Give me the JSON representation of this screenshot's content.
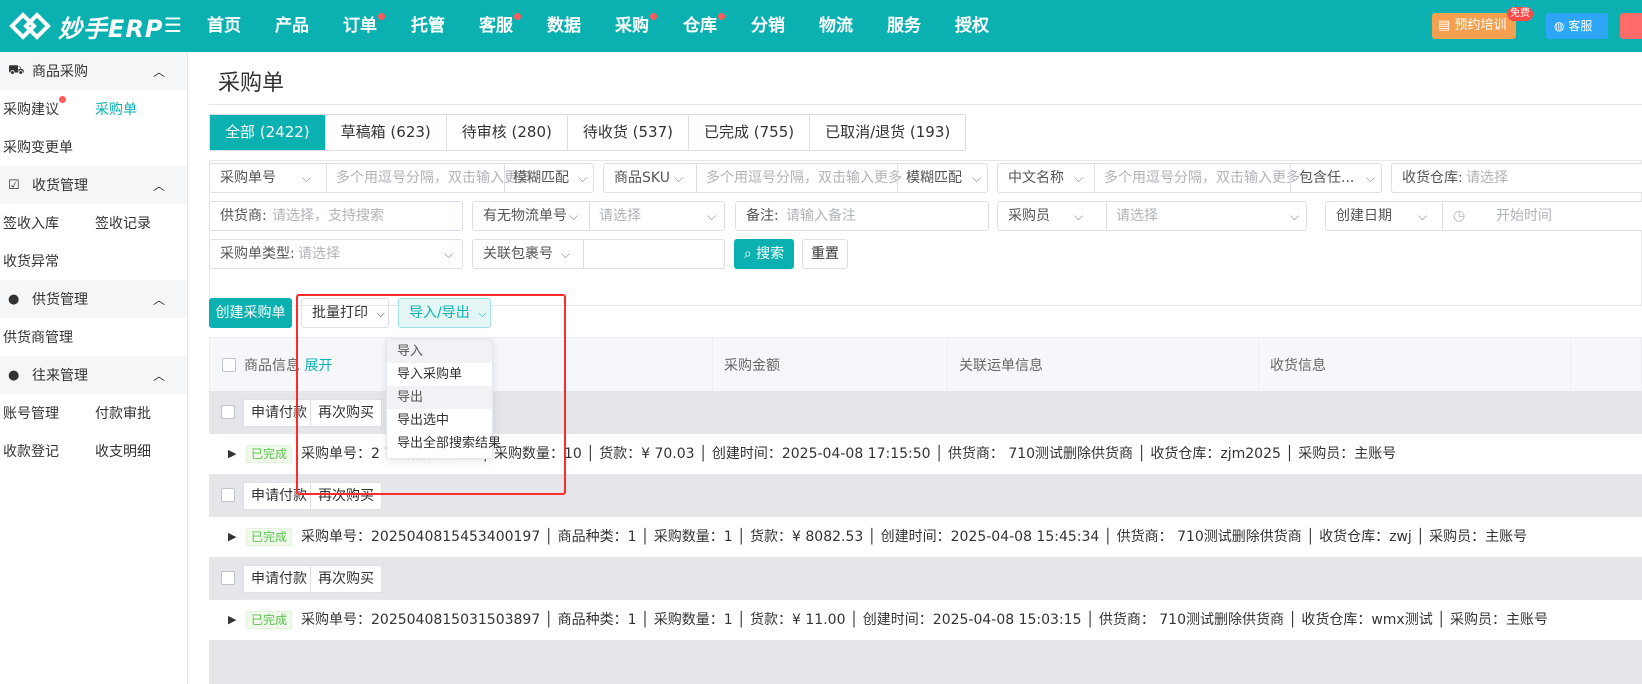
{
  "app": {
    "logo_text": "妙手ERP",
    "nav": [
      {
        "label": "首页",
        "dot": false
      },
      {
        "label": "产品",
        "dot": false
      },
      {
        "label": "订单",
        "dot": true
      },
      {
        "label": "托管",
        "dot": false
      },
      {
        "label": "客服",
        "dot": true
      },
      {
        "label": "数据",
        "dot": false
      },
      {
        "label": "采购",
        "dot": true
      },
      {
        "label": "仓库",
        "dot": true
      },
      {
        "label": "分销",
        "dot": false
      },
      {
        "label": "物流",
        "dot": false
      },
      {
        "label": "服务",
        "dot": false
      },
      {
        "label": "授权",
        "dot": false
      }
    ],
    "training_label": "预约培训",
    "free_badge": "免费",
    "service_label": "客服"
  },
  "sidebar": {
    "groups": [
      {
        "title": "商品采购",
        "icon": "cart-icon",
        "rows": [
          [
            "采购建议",
            "采购单"
          ],
          [
            "采购变更单"
          ]
        ]
      },
      {
        "title": "收货管理",
        "icon": "clipboard-check-icon",
        "rows": [
          [
            "签收入库",
            "签收记录"
          ],
          [
            "收货异常"
          ]
        ]
      },
      {
        "title": "供货管理",
        "icon": "user-gear-icon",
        "rows": [
          [
            "供货商管理"
          ]
        ]
      },
      {
        "title": "往来管理",
        "icon": "user-icon",
        "rows": [
          [
            "账号管理",
            "付款审批"
          ],
          [
            "收款登记",
            "收支明细"
          ]
        ]
      }
    ]
  },
  "page": {
    "title": "采购单"
  },
  "tabs": [
    "全部 (2422)",
    "草稿箱 (623)",
    "待审核 (280)",
    "待收货 (537)",
    "已完成 (755)",
    "已取消/退货 (193)"
  ],
  "filters": {
    "order_no_label": "采购单号",
    "order_no_ph": "多个用逗号分隔，双击输入更多",
    "fuzzy1": "模糊匹配",
    "sku_label": "商品SKU",
    "sku_ph": "多个用逗号分隔，双击输入更多",
    "fuzzy2": "模糊匹配",
    "cn_name_label": "中文名称",
    "cn_name_ph": "多个用逗号分隔，双击输入更多",
    "contains": "包含任...",
    "warehouse_label": "收货仓库:",
    "warehouse_ph": "请选择",
    "supplier_label": "供货商:",
    "supplier_ph": "请选择，支持搜索",
    "logistics_label": "有无物流单号",
    "logistics_ph": "请选择",
    "remark_label": "备注:",
    "remark_ph": "请输入备注",
    "buyer_label": "采购员",
    "buyer_ph": "请选择",
    "date_label": "创建日期",
    "date_ph": "开始时间",
    "type_label": "采购单类型:",
    "type_ph": "请选择",
    "package_label": "关联包裹号",
    "search_btn": "搜索",
    "reset_btn": "重置"
  },
  "toolbar": {
    "create": "创建采购单",
    "print": "批量打印",
    "impexp": "导入/导出"
  },
  "dropdown": [
    "导入",
    "导入采购单",
    "导出",
    "导出选中",
    "导出全部搜索结果"
  ],
  "table": {
    "headers": {
      "goods": "商品信息",
      "expand": "展开",
      "amount": "采购金额",
      "waybill": "关联运单信息",
      "receive": "收货信息"
    },
    "action_labels": [
      "申请付款",
      "再次购买"
    ],
    "rows": [
      {
        "status": "已完成",
        "info": "采购单号：2               7    商品种类：3  │  采购数量：10  │  货款：¥ 70.03  │  创建时间：2025-04-08 17:15:50  │  供货商：  710测试删除供货商  │  收货仓库：zjm2025  │  采购员：主账号"
      },
      {
        "status": "已完成",
        "info": "采购单号：2025040815453400197  │  商品种类：1  │  采购数量：1  │  货款：¥ 8082.53  │  创建时间：2025-04-08 15:45:34  │  供货商：  710测试删除供货商  │  收货仓库：zwj  │  采购员：主账号"
      },
      {
        "status": "已完成",
        "info": "采购单号：2025040815031503897  │  商品种类：1  │  采购数量：1  │  货款：¥ 11.00  │  创建时间：2025-04-08 15:03:15  │  供货商：  710测试删除供货商  │  收货仓库：wmx测试  │  采购员：主账号"
      }
    ]
  },
  "colors": {
    "brand": "#0bb1b1",
    "highlight": "#ff2a2a"
  }
}
